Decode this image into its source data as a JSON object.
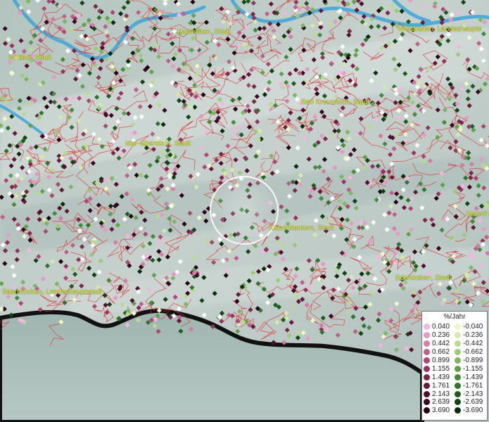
{
  "map": {
    "cities": [
      {
        "id": "wittlich",
        "label": "Wittlich, Stadt"
      },
      {
        "id": "kastellaun",
        "label": "Kastellaun, Stadt"
      },
      {
        "id": "wiesbaden",
        "label": "Wiesbaden, Landeshaupts"
      },
      {
        "id": "bad-kreuznach",
        "label": "Bad Kreuznach, Stadt"
      },
      {
        "id": "idar-oberstein",
        "label": "Idar-Oberstein, Stadt"
      },
      {
        "id": "kaiserslautern",
        "label": "Kaiserslautern, Stadt"
      },
      {
        "id": "mannheim",
        "label": "Mannh"
      },
      {
        "id": "saarbruecken",
        "label": "Saarbrücken, Landeshauptstadt"
      },
      {
        "id": "edenkoben",
        "label": "Edenkoben, Stadt"
      }
    ],
    "colors": {
      "border_lines": "#e0302c",
      "rivers": "#3aa6d8",
      "label_text": "#e9ef1b",
      "selection_circle": "#ffffff"
    }
  },
  "legend": {
    "title": "%/Jahr",
    "positive": [
      {
        "value": "0.040",
        "color": "#f4b6e0"
      },
      {
        "value": "0.236",
        "color": "#e897c6"
      },
      {
        "value": "0.442",
        "color": "#d67aa9"
      },
      {
        "value": "0.662",
        "color": "#c15e8e"
      },
      {
        "value": "0.899",
        "color": "#ac4774"
      },
      {
        "value": "1.155",
        "color": "#96345f"
      },
      {
        "value": "1.439",
        "color": "#80244c"
      },
      {
        "value": "1.761",
        "color": "#6a173c"
      },
      {
        "value": "2.143",
        "color": "#530d2e"
      },
      {
        "value": "2.639",
        "color": "#3c0621"
      },
      {
        "value": "3.690",
        "color": "#260214"
      }
    ],
    "negative": [
      {
        "value": "-0.040",
        "color": "#f1f6c2"
      },
      {
        "value": "-0.236",
        "color": "#d6eaa5"
      },
      {
        "value": "-0.442",
        "color": "#b9db8b"
      },
      {
        "value": "-0.662",
        "color": "#9bcb73"
      },
      {
        "value": "-0.899",
        "color": "#7cb95e"
      },
      {
        "value": "-1.155",
        "color": "#5ea34a"
      },
      {
        "value": "-1.439",
        "color": "#448c38"
      },
      {
        "value": "-1.761",
        "color": "#2e7529"
      },
      {
        "value": "-2.143",
        "color": "#1d5d1c"
      },
      {
        "value": "-2.639",
        "color": "#104611"
      },
      {
        "value": "-3.690",
        "color": "#062e08"
      }
    ]
  }
}
